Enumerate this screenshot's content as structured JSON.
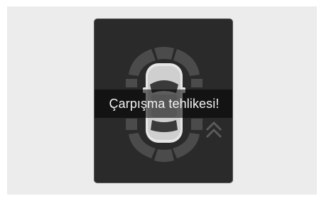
{
  "warning": {
    "message": "Çarpışma tehlikesi!"
  },
  "display": {
    "icons": [
      "car-top-view-icon",
      "parking-sensor-zones",
      "approach-chevron-icon"
    ]
  },
  "colors": {
    "screen_bg": "#2a2a2a",
    "zone_inactive": "#4b4b4b",
    "banner_text": "#f2f2f2",
    "frame_bg": "#ececec"
  }
}
